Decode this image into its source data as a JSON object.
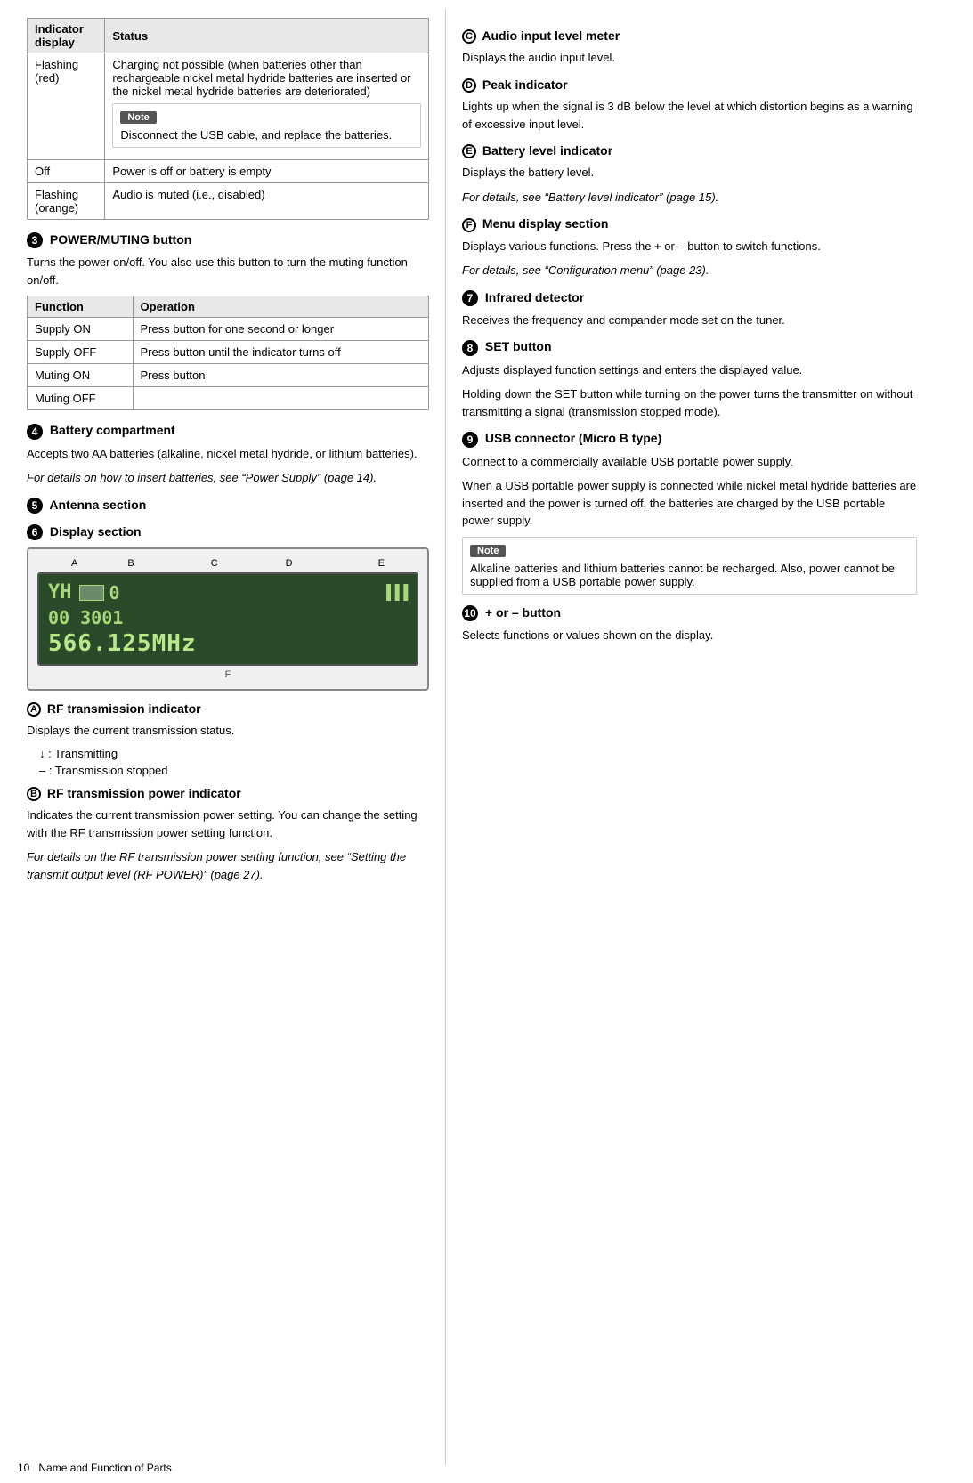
{
  "page": {
    "number": "10",
    "footer_label": "Name and Function of Parts"
  },
  "left_column": {
    "table1": {
      "headers": [
        "Indicator display",
        "Status"
      ],
      "rows": [
        {
          "col1": "Flashing (red)",
          "col2": "Charging not possible (when batteries other than rechargeable nickel metal hydride batteries are inserted or the nickel metal hydride batteries are deteriorated)",
          "has_note": true,
          "note_text": "Disconnect the USB cable, and replace the batteries."
        },
        {
          "col1": "Off",
          "col2": "Power is off or battery is empty",
          "has_note": false
        },
        {
          "col1": "Flashing (orange)",
          "col2": "Audio is muted (i.e., disabled)",
          "has_note": false
        }
      ]
    },
    "section3": {
      "num": "3",
      "title": "POWER/MUTING button",
      "desc": "Turns the power on/off. You also use this button to turn the muting function on/off.",
      "table2": {
        "headers": [
          "Function",
          "Operation"
        ],
        "rows": [
          {
            "col1": "Supply ON",
            "col2": "Press button for one second or longer"
          },
          {
            "col1": "Supply OFF",
            "col2": "Press button until the indicator turns off"
          },
          {
            "col1": "Muting ON",
            "col2": "Press button"
          },
          {
            "col1": "Muting OFF",
            "col2": ""
          }
        ]
      }
    },
    "section4": {
      "num": "4",
      "title": "Battery compartment",
      "desc": "Accepts two AA batteries (alkaline, nickel metal hydride, or lithium batteries).",
      "ref": "For details on how to insert batteries, see “Power Supply” (page 14)."
    },
    "section5": {
      "num": "5",
      "title": "Antenna section"
    },
    "section6": {
      "num": "6",
      "title": "Display section",
      "display_labels": [
        "A",
        "B",
        "C",
        "D",
        "E"
      ],
      "display_bottom_label": "F",
      "display_row1_left": "YH",
      "display_row1_mid": "00",
      "display_row1_right": "███",
      "display_ch": "00    3001",
      "display_freq": "566.125MHz"
    },
    "sectionA": {
      "letter": "A",
      "title": "RF transmission indicator",
      "desc": "Displays the current transmission status.",
      "bullet1": "↓ : Transmitting",
      "bullet2": "– : Transmission stopped"
    },
    "sectionB": {
      "letter": "B",
      "title": "RF transmission power indicator",
      "desc": "Indicates the current transmission power setting. You can change the setting with the RF transmission power setting function.",
      "ref": "For details on the RF transmission power setting function, see “Setting the transmit output level (RF POWER)” (page 27)."
    }
  },
  "right_column": {
    "sectionC": {
      "letter": "C",
      "title": "Audio input level meter",
      "desc": "Displays the audio input level."
    },
    "sectionD": {
      "letter": "D",
      "title": "Peak indicator",
      "desc": "Lights up when the signal is 3 dB below the level at which distortion begins as a warning of excessive input level."
    },
    "sectionE": {
      "letter": "E",
      "title": "Battery level indicator",
      "desc": "Displays the battery level.",
      "ref": "For details, see “Battery level indicator” (page 15)."
    },
    "sectionF": {
      "letter": "F",
      "title": "Menu display section",
      "desc": "Displays various functions. Press the + or – button to switch functions.",
      "ref": "For details, see “Configuration menu” (page 23)."
    },
    "section7": {
      "num": "7",
      "title": "Infrared detector",
      "desc": "Receives the frequency and compander mode set on the tuner."
    },
    "section8": {
      "num": "8",
      "title": "SET button",
      "desc1": "Adjusts displayed function settings and enters the displayed value.",
      "desc2": "Holding down the SET button while turning on the power turns the transmitter on without transmitting a signal (transmission stopped mode)."
    },
    "section9": {
      "num": "9",
      "title": "USB connector (Micro B type)",
      "desc1": "Connect to a commercially available USB portable power supply.",
      "desc2": "When a USB portable power supply is connected while nickel metal hydride batteries are inserted and the power is turned off, the batteries are charged by the USB portable power supply.",
      "note_label": "Note",
      "note_text": "Alkaline batteries and lithium batteries cannot be recharged. Also, power cannot be supplied from a USB portable power supply."
    },
    "section10": {
      "num": "10",
      "symbol": "⊕",
      "title": "+ or – button",
      "desc": "Selects functions or values shown on the display."
    }
  }
}
